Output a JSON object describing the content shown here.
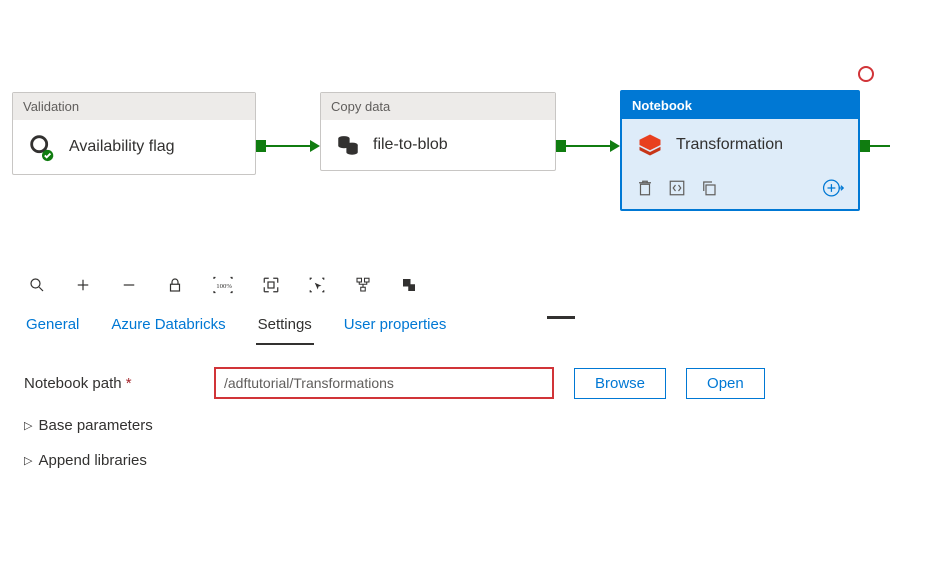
{
  "canvas": {
    "nodes": {
      "validation": {
        "type": "Validation",
        "title": "Availability flag"
      },
      "copy": {
        "type": "Copy data",
        "title": "file-to-blob"
      },
      "notebook": {
        "type": "Notebook",
        "title": "Transformation"
      }
    }
  },
  "tabs": {
    "general": "General",
    "databricks": "Azure Databricks",
    "settings": "Settings",
    "userprops": "User properties"
  },
  "settings": {
    "notebook_path_label": "Notebook path",
    "notebook_path_value": "/adftutorial/Transformations",
    "browse": "Browse",
    "open": "Open",
    "base_parameters": "Base parameters",
    "append_libraries": "Append libraries"
  }
}
